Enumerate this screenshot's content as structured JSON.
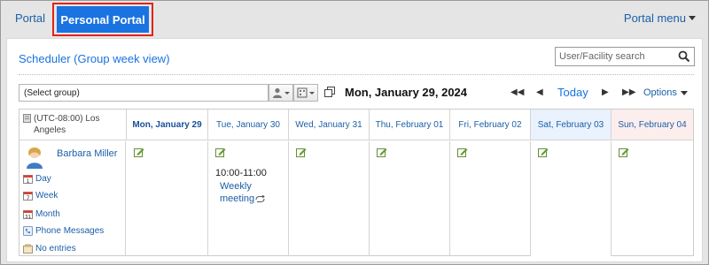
{
  "tabs": {
    "portal": "Portal",
    "personal_portal": "Personal Portal",
    "portal_menu": "Portal menu"
  },
  "panel": {
    "title": "Scheduler (Group week view)",
    "search_placeholder": "User/Facility search"
  },
  "toolbar": {
    "group_select": "(Select group)",
    "current_date": "Mon, January 29, 2024",
    "today": "Today",
    "options": "Options"
  },
  "grid": {
    "timezone": "(UTC-08:00) Los Angeles",
    "days": [
      "Mon, January 29",
      "Tue, January 30",
      "Wed, January 31",
      "Thu, February 01",
      "Fri, February 02",
      "Sat, February 03",
      "Sun, February 04"
    ],
    "user": {
      "name": "Barbara Miller",
      "links": [
        "Day",
        "Week",
        "Month",
        "Phone Messages",
        "No entries"
      ]
    },
    "event": {
      "time": "10:00-11:00",
      "title_line1": "Weekly",
      "title_line2": "meeting"
    }
  },
  "colors": {
    "accent": "#1a73e0",
    "highlight_border": "#e2231a",
    "saturday_bg": "#e9f2fd",
    "sunday_bg": "#fdeeee"
  }
}
